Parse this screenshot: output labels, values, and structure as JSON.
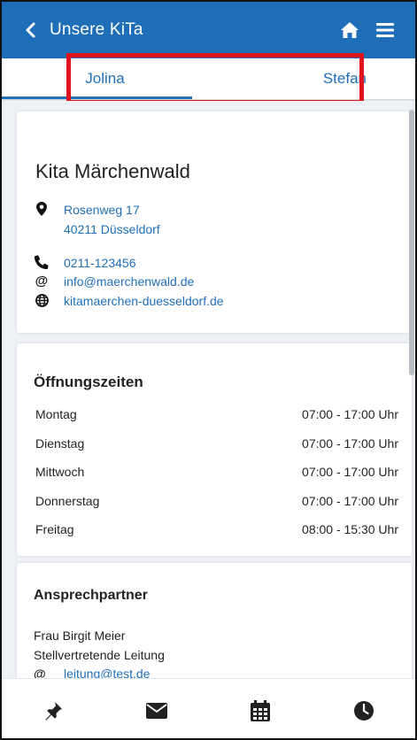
{
  "header": {
    "title": "Unsere KiTa",
    "background": "#1f6fb8",
    "icons": {
      "back": "chevron-left-icon",
      "home": "home-icon",
      "menu": "hamburger-menu-icon"
    }
  },
  "tabs": [
    {
      "label": "Jolina",
      "active": true
    },
    {
      "label": "Stefan",
      "active": false
    }
  ],
  "highlight_color": "#e0141c",
  "kita": {
    "name": "Kita Märchenwald",
    "address_line1": "Rosenweg 17",
    "address_line2": "40211 Düsseldorf",
    "phone": "0211-123456",
    "email": "info@maerchenwald.de",
    "website": "kitamaerchen-duesseldorf.de"
  },
  "opening_hours": {
    "title": "Öffnungszeiten",
    "rows": [
      {
        "day": "Montag",
        "time": "07:00 - 17:00 Uhr"
      },
      {
        "day": "Dienstag",
        "time": "07:00 - 17:00 Uhr"
      },
      {
        "day": "Mittwoch",
        "time": "07:00 - 17:00 Uhr"
      },
      {
        "day": "Donnerstag",
        "time": "07:00 - 17:00 Uhr"
      },
      {
        "day": "Freitag",
        "time": "08:00 - 15:30 Uhr"
      }
    ]
  },
  "contact": {
    "title": "Ansprechpartner",
    "name": "Frau Birgit Meier",
    "role": "Stellvertretende Leitung",
    "email": "leitung@test.de"
  },
  "bottom_nav": [
    {
      "icon": "pin-icon"
    },
    {
      "icon": "mail-icon"
    },
    {
      "icon": "calendar-icon"
    },
    {
      "icon": "clock-icon"
    }
  ]
}
